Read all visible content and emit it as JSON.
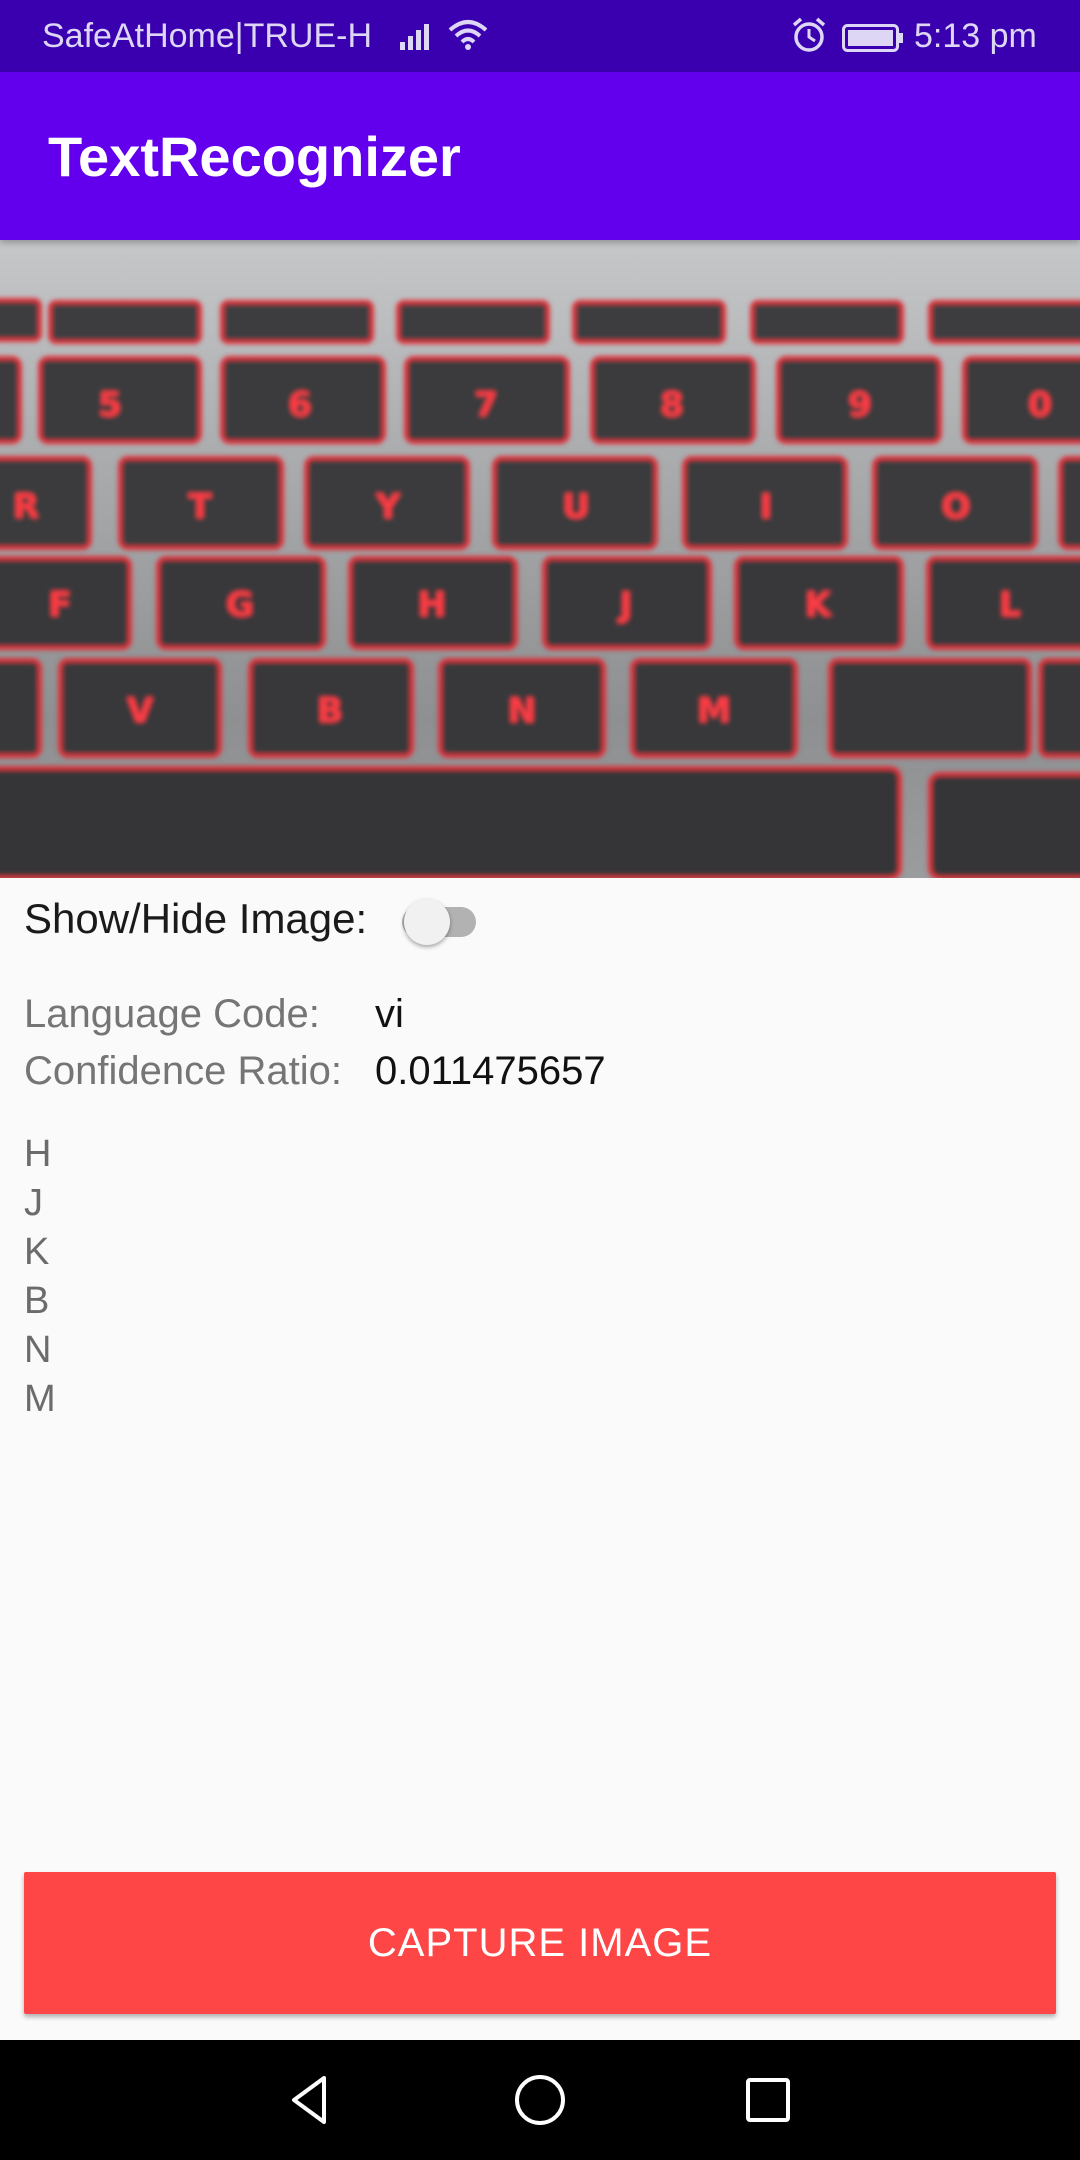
{
  "status_bar": {
    "carrier": "SafeAtHome|TRUE-H",
    "time": "5:13 pm",
    "icons": [
      "signal-icon",
      "wifi-icon",
      "alarm-icon",
      "battery-icon"
    ]
  },
  "app_bar": {
    "title": "TextRecognizer",
    "color": "#6200ee"
  },
  "image_preview": {
    "description_icon": "keyboard-photo"
  },
  "toggle": {
    "label": "Show/Hide Image:",
    "checked": false
  },
  "language": {
    "label": "Language Code:",
    "value": "vi"
  },
  "confidence": {
    "label": "Confidence Ratio:",
    "value": "0.011475657"
  },
  "recognized_lines": [
    "H",
    "J",
    "K",
    "B",
    "N",
    "M"
  ],
  "capture": {
    "label": "CAPTURE IMAGE",
    "color": "#fe4647"
  },
  "nav_bar": {
    "icons": [
      "back-icon",
      "home-icon",
      "recents-icon"
    ]
  }
}
